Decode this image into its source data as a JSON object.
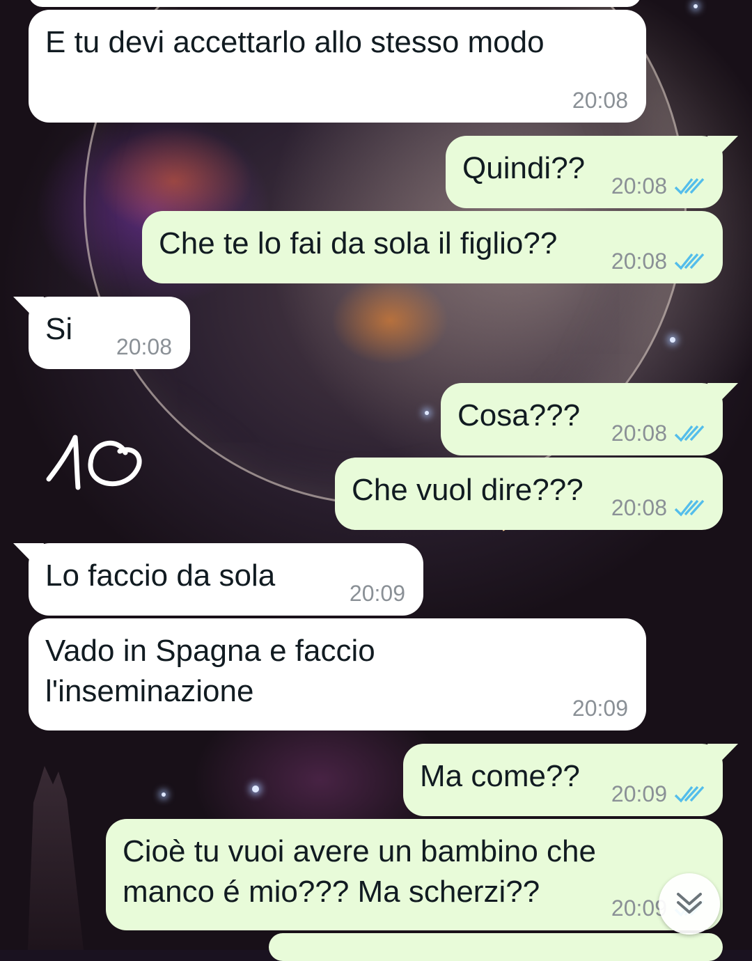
{
  "messages": [
    {
      "direction": "incoming",
      "text": "E tu devi accettarlo allo stesso modo",
      "time": "20:08"
    },
    {
      "direction": "outgoing",
      "text": "Quindi??",
      "time": "20:08",
      "status": "read"
    },
    {
      "direction": "outgoing",
      "text": "Che te lo fai da sola il figlio??",
      "time": "20:08",
      "status": "read"
    },
    {
      "direction": "incoming",
      "text": "Si",
      "time": "20:08"
    },
    {
      "direction": "outgoing",
      "text": "Cosa???",
      "time": "20:08",
      "status": "read"
    },
    {
      "direction": "outgoing",
      "text": "Che vuol dire???",
      "time": "20:08",
      "status": "read"
    },
    {
      "direction": "incoming",
      "text": "Lo faccio da sola",
      "time": "20:09"
    },
    {
      "direction": "incoming",
      "lines": [
        "Vado in Spagna e faccio",
        "l'inseminazione"
      ],
      "time": "20:09"
    },
    {
      "direction": "outgoing",
      "text": "Ma come??",
      "time": "20:09",
      "status": "read"
    },
    {
      "direction": "outgoing",
      "lines": [
        "Cioè tu vuoi avere un bambino che",
        "manco é mio??? Ma scherzi??"
      ],
      "time": "20:09",
      "status": "read"
    }
  ],
  "annotation": {
    "handwritten": "10",
    "color": "#ffffff"
  },
  "icons": {
    "read_receipt": "double-check-icon",
    "scroll_down": "chevron-down-icon"
  },
  "colors": {
    "incoming_bubble": "#ffffff",
    "outgoing_bubble": "#e8fbd9",
    "timestamp": "#8a9096",
    "read_tick": "#53bdeb"
  }
}
